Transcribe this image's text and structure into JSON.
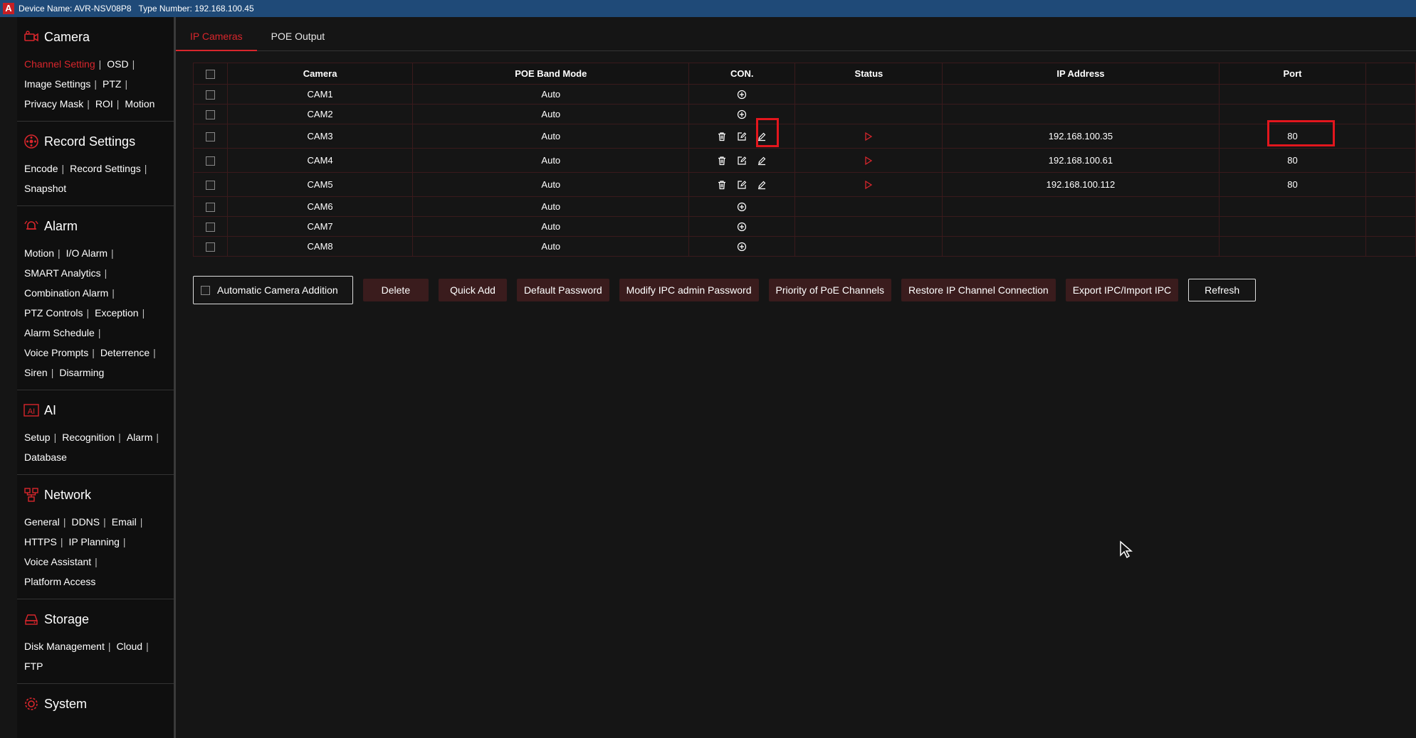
{
  "titlebar": {
    "device_label": "Device Name: AVR-NSV08P8",
    "type_label": "Type Number: 192.168.100.45",
    "logo_letter": "A"
  },
  "sidebar": {
    "camera": {
      "title": "Camera",
      "links": [
        "Channel Setting",
        "OSD",
        "Image Settings",
        "PTZ",
        "Privacy Mask",
        "ROI",
        "Motion"
      ]
    },
    "record": {
      "title": "Record Settings",
      "links": [
        "Encode",
        "Record Settings",
        "Snapshot"
      ]
    },
    "alarm": {
      "title": "Alarm",
      "links": [
        "Motion",
        "I/O Alarm",
        "SMART Analytics",
        "Combination Alarm",
        "PTZ Controls",
        "Exception",
        "Alarm Schedule",
        "Voice Prompts",
        "Deterrence",
        "Siren",
        "Disarming"
      ]
    },
    "ai": {
      "title": "AI",
      "icon_text": "AI",
      "links": [
        "Setup",
        "Recognition",
        "Alarm",
        "Database"
      ]
    },
    "network": {
      "title": "Network",
      "links": [
        "General",
        "DDNS",
        "Email",
        "HTTPS",
        "IP Planning",
        "Voice Assistant",
        "Platform Access"
      ]
    },
    "storage": {
      "title": "Storage",
      "links": [
        "Disk Management",
        "Cloud",
        "FTP"
      ]
    },
    "system": {
      "title": "System"
    },
    "separator": "|"
  },
  "tabs": [
    {
      "label": "IP Cameras"
    },
    {
      "label": "POE Output"
    }
  ],
  "table": {
    "headers": {
      "camera": "Camera",
      "poe": "POE Band Mode",
      "con": "CON.",
      "status": "Status",
      "ip": "IP Address",
      "port": "Port"
    },
    "rows": [
      {
        "camera": "CAM1",
        "poe": "Auto",
        "ip": "",
        "port": ""
      },
      {
        "camera": "CAM2",
        "poe": "Auto",
        "ip": "",
        "port": ""
      },
      {
        "camera": "CAM3",
        "poe": "Auto",
        "ip": "192.168.100.35",
        "port": "80"
      },
      {
        "camera": "CAM4",
        "poe": "Auto",
        "ip": "192.168.100.61",
        "port": "80"
      },
      {
        "camera": "CAM5",
        "poe": "Auto",
        "ip": "192.168.100.112",
        "port": "80"
      },
      {
        "camera": "CAM6",
        "poe": "Auto",
        "ip": "",
        "port": ""
      },
      {
        "camera": "CAM7",
        "poe": "Auto",
        "ip": "",
        "port": ""
      },
      {
        "camera": "CAM8",
        "poe": "Auto",
        "ip": "",
        "port": ""
      }
    ]
  },
  "buttons": {
    "auto_add": "Automatic Camera Addition",
    "delete": "Delete",
    "quick_add": "Quick Add",
    "default_password": "Default Password",
    "modify_ipc": "Modify IPC admin Password",
    "priority_poe": "Priority of PoE Channels",
    "restore_ip": "Restore IP Channel Connection",
    "export_import": "Export IPC/Import IPC",
    "refresh": "Refresh"
  },
  "colors": {
    "accent": "#d8262c",
    "highlight_box": "#e3161d",
    "titlebar": "#1f4a78"
  }
}
